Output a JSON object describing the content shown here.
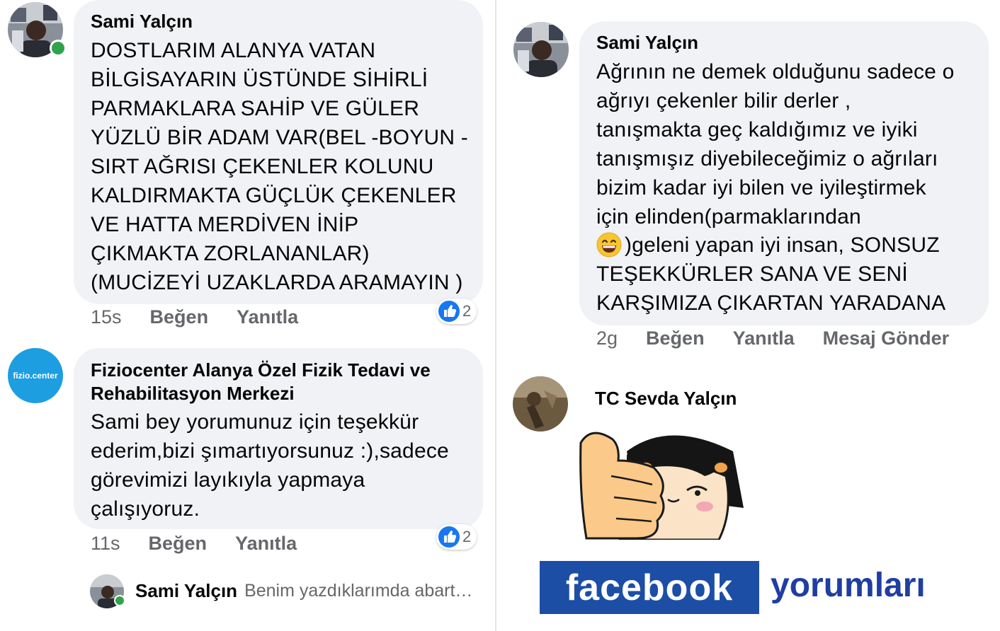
{
  "left_column": {
    "comment1": {
      "author": "Sami Yalçın",
      "text": "DOSTLARIM ALANYA VATAN\nBİLGİSAYARIN  ÜSTÜNDE SİHİRLİ\nPARMAKLARA SAHİP VE GÜLER\nYÜZLÜ BİR ADAM VAR(BEL -BOYUN -\nSIRT AĞRISI ÇEKENLER KOLUNU\nKALDIRMAKTA GÜÇLÜK ÇEKENLER\nVE HATTA MERDİVEN İNİP\nÇIKMAKTA ZORLANANLAR)\n(MUCİZEYİ UZAKLARDA ARAMAYIN )",
      "time": "15s",
      "like_label": "Beğen",
      "reply_label": "Yanıtla",
      "reaction_count": "2"
    },
    "comment2": {
      "author_line1": "Fiziocenter Alanya Özel Fizik Tedavi ve",
      "author_line2": "Rehabilitasyon Merkezi",
      "avatar_text": "fizio.center",
      "text": "Sami bey yorumunuz için teşekkür\nederim,bizi şımartıyorsunuz :),sadece\ngörevimizi layıkıyla yapmaya\nçalışıyoruz.",
      "time": "11s",
      "like_label": "Beğen",
      "reply_label": "Yanıtla",
      "reaction_count": "2"
    },
    "reply_preview": {
      "author": "Sami Yalçın",
      "text": "Benim yazdıklarımda abart…"
    }
  },
  "right_column": {
    "comment3": {
      "author": "Sami Yalçın",
      "text_before_emoji": "Ağrının ne demek olduğunu sadece o\nağrıyı çekenler bilir derler ,\ntanışmakta geç kaldığımız ve iyiki\ntanışmışız diyebileceğimiz o ağrıları\nbizim kadar iyi bilen ve iyileştirmek\niçin elinden(parmaklarından",
      "text_after_emoji": ")geleni yapan iyi insan, SONSUZ\nTEŞEKKÜRLER SANA VE SENİ\nKARŞIMIZA ÇIKARTAN YARADANA",
      "time": "2g",
      "like_label": "Beğen",
      "reply_label": "Yanıtla",
      "message_label": "Mesaj Gönder"
    },
    "comment4": {
      "author": "TC Sevda Yalçın",
      "sticker": "thumbs-up-girl-sticker"
    }
  },
  "branding": {
    "logo_text": "facebook",
    "caption": "yorumları"
  },
  "colors": {
    "bubble": "#f0f2f5",
    "muted": "#65676b",
    "like_blue": "#1877f2",
    "online": "#31a24c",
    "fb_blue": "#1c4ea6"
  }
}
